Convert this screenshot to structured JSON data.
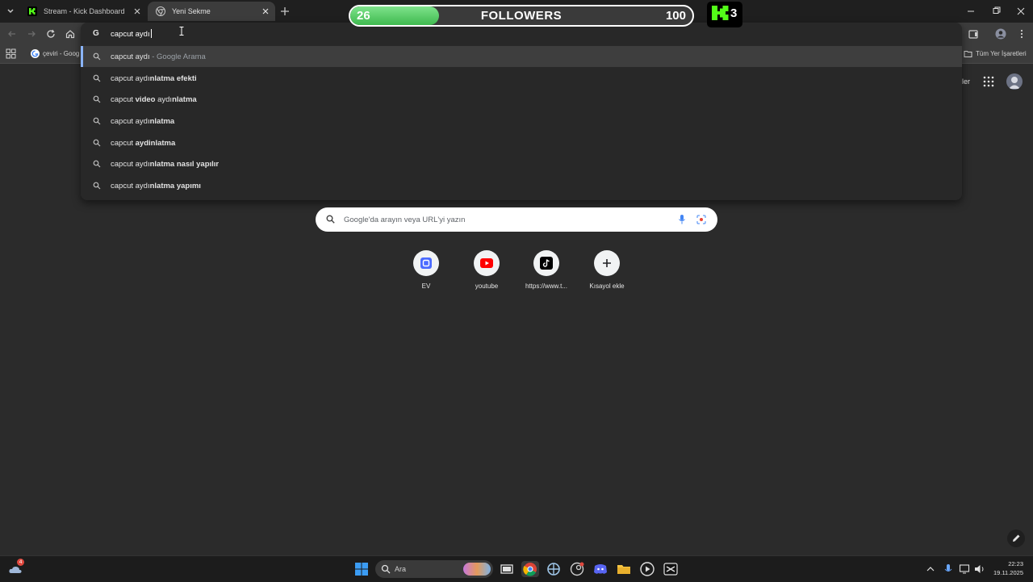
{
  "tabs": [
    {
      "title": "Stream - Kick Dashboard",
      "favicon": "kick-icon",
      "active": false
    },
    {
      "title": "Yeni Sekme",
      "favicon": "chrome-icon",
      "active": true
    }
  ],
  "overlay": {
    "followers_current": "26",
    "followers_label": "FOLLOWERS",
    "followers_goal": "100",
    "progress_fraction": 0.26,
    "kick_count": "3",
    "accent": "#53fc18"
  },
  "omnibox": {
    "typed": "capcut aydı",
    "engine_icon": "google-g-icon",
    "suggestions": [
      {
        "plain": "capcut aydı",
        "bold": "",
        "sub": " - Google Arama",
        "selected": true
      },
      {
        "plain": "capcut aydı",
        "bold": "nlatma efekti",
        "sub": "",
        "selected": false
      },
      {
        "plain": "capcut ",
        "bold": "video ",
        "plain2": "aydı",
        "bold2": "nlatma",
        "sub": "",
        "selected": false
      },
      {
        "plain": "capcut aydı",
        "bold": "nlatma",
        "sub": "",
        "selected": false
      },
      {
        "plain": "capcut ",
        "bold": "aydinlatma",
        "sub": "",
        "selected": false
      },
      {
        "plain": "capcut aydı",
        "bold": "nlatma nasıl yapılır",
        "sub": "",
        "selected": false
      },
      {
        "plain": "capcut aydı",
        "bold": "nlatma yapımı",
        "sub": "",
        "selected": false
      }
    ]
  },
  "bookmarks": {
    "first": "çeviri - Goog",
    "all_bookmarks": "Tüm Yer İşaretleri",
    "partial_right": "ler"
  },
  "ntp": {
    "search_placeholder": "Google'da arayın veya URL'yi yazın",
    "shortcuts": [
      {
        "label": "EV",
        "icon": "ev-app-icon"
      },
      {
        "label": "youtube",
        "icon": "youtube-icon"
      },
      {
        "label": "https://www.t...",
        "icon": "tiktok-icon"
      },
      {
        "label": "Kısayol ekle",
        "icon": "plus-icon"
      }
    ]
  },
  "taskbar": {
    "search_label": "Ara",
    "weather_badge": "4",
    "time": "22:23",
    "date": "19.11.2025"
  }
}
